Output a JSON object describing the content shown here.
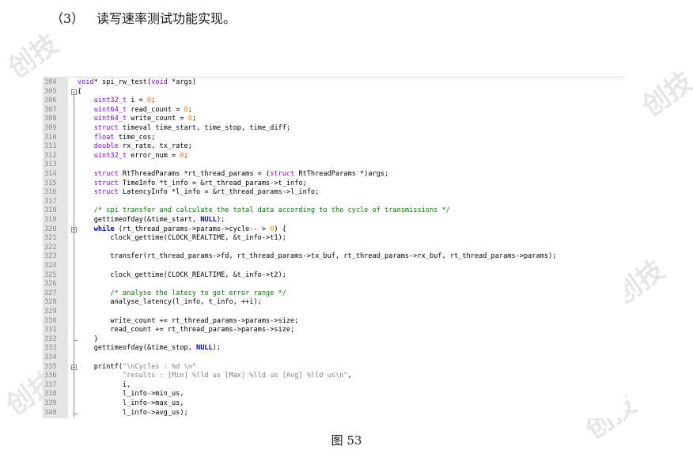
{
  "heading": {
    "number": "（3）",
    "title": "读写速率测试功能实现。"
  },
  "watermark": "创技",
  "caption": "图  53",
  "code_lines": [
    {
      "n": "304",
      "fold": "",
      "segs": [
        [
          "t",
          "void"
        ],
        [
          "",
          "* spi_rw_test("
        ],
        [
          "t",
          "void"
        ],
        [
          "",
          " *args)"
        ]
      ]
    },
    {
      "n": "305",
      "fold": "open",
      "segs": [
        [
          "",
          "{"
        ]
      ]
    },
    {
      "n": "306",
      "fold": "",
      "segs": [
        [
          "",
          "    "
        ],
        [
          "t",
          "uint32_t"
        ],
        [
          "",
          " i = "
        ],
        [
          "n",
          "0"
        ],
        [
          "",
          ";"
        ]
      ]
    },
    {
      "n": "307",
      "fold": "",
      "segs": [
        [
          "",
          "    "
        ],
        [
          "t",
          "uint64_t"
        ],
        [
          "",
          " read_count = "
        ],
        [
          "n",
          "0"
        ],
        [
          "",
          ";"
        ]
      ]
    },
    {
      "n": "308",
      "fold": "",
      "segs": [
        [
          "",
          "    "
        ],
        [
          "t",
          "uint64_t"
        ],
        [
          "",
          " write_count = "
        ],
        [
          "n",
          "0"
        ],
        [
          "",
          ";"
        ]
      ]
    },
    {
      "n": "309",
      "fold": "",
      "segs": [
        [
          "",
          "    "
        ],
        [
          "t",
          "struct"
        ],
        [
          "",
          " timeval time_start, time_stop, time_diff;"
        ]
      ]
    },
    {
      "n": "310",
      "fold": "",
      "segs": [
        [
          "",
          "    "
        ],
        [
          "t",
          "float"
        ],
        [
          "",
          " time_cos;"
        ]
      ]
    },
    {
      "n": "311",
      "fold": "",
      "segs": [
        [
          "",
          "    "
        ],
        [
          "t",
          "double"
        ],
        [
          "",
          " rx_rate, tx_rate;"
        ]
      ]
    },
    {
      "n": "312",
      "fold": "",
      "segs": [
        [
          "",
          "    "
        ],
        [
          "t",
          "uint32_t"
        ],
        [
          "",
          " error_num = "
        ],
        [
          "n",
          "0"
        ],
        [
          "",
          ";"
        ]
      ]
    },
    {
      "n": "313",
      "fold": "",
      "segs": []
    },
    {
      "n": "314",
      "fold": "",
      "segs": [
        [
          "",
          "    "
        ],
        [
          "t",
          "struct"
        ],
        [
          "",
          " RtThreadParams *rt_thread_params = ("
        ],
        [
          "t",
          "struct"
        ],
        [
          "",
          " RtThreadParams *)args;"
        ]
      ]
    },
    {
      "n": "315",
      "fold": "",
      "segs": [
        [
          "",
          "    "
        ],
        [
          "t",
          "struct"
        ],
        [
          "",
          " TimeInfo *t_info = &rt_thread_params->t_info;"
        ]
      ]
    },
    {
      "n": "316",
      "fold": "",
      "segs": [
        [
          "",
          "    "
        ],
        [
          "t",
          "struct"
        ],
        [
          "",
          " LatencyInfo *l_info = &rt_thread_params->l_info;"
        ]
      ]
    },
    {
      "n": "317",
      "fold": "",
      "segs": []
    },
    {
      "n": "318",
      "fold": "",
      "segs": [
        [
          "",
          "    "
        ],
        [
          "c",
          "/* spi transfer and calculate the total data according to the cycle of transmissions */"
        ]
      ]
    },
    {
      "n": "319",
      "fold": "",
      "segs": [
        [
          "",
          "    gettimeofday(&time_start, "
        ],
        [
          "k",
          "NULL"
        ],
        [
          "",
          ");"
        ]
      ]
    },
    {
      "n": "320",
      "fold": "open",
      "segs": [
        [
          "",
          "    "
        ],
        [
          "k",
          "while"
        ],
        [
          "",
          " (rt_thread_params->params->cycle-- > "
        ],
        [
          "n",
          "0"
        ],
        [
          "",
          ") {"
        ]
      ]
    },
    {
      "n": "321",
      "fold": "",
      "segs": [
        [
          "",
          "        clock_gettime(CLOCK_REALTIME, &t_info->t1);"
        ]
      ]
    },
    {
      "n": "322",
      "fold": "",
      "segs": []
    },
    {
      "n": "323",
      "fold": "",
      "segs": [
        [
          "",
          "        transfer(rt_thread_params->fd, rt_thread_params->tx_buf, rt_thread_params->rx_buf, rt_thread_params->params);"
        ]
      ]
    },
    {
      "n": "324",
      "fold": "",
      "segs": []
    },
    {
      "n": "325",
      "fold": "",
      "segs": [
        [
          "",
          "        clock_gettime(CLOCK_REALTIME, &t_info->t2);"
        ]
      ]
    },
    {
      "n": "326",
      "fold": "",
      "segs": []
    },
    {
      "n": "327",
      "fold": "",
      "segs": [
        [
          "",
          "        "
        ],
        [
          "c",
          "/* analyse the latecy to get error range */"
        ]
      ]
    },
    {
      "n": "328",
      "fold": "",
      "segs": [
        [
          "",
          "        analyse_latency(l_info, t_info, ++i);"
        ]
      ]
    },
    {
      "n": "329",
      "fold": "",
      "segs": []
    },
    {
      "n": "330",
      "fold": "",
      "segs": [
        [
          "",
          "        write_count += rt_thread_params->params->size;"
        ]
      ]
    },
    {
      "n": "331",
      "fold": "",
      "segs": [
        [
          "",
          "        read_count += rt_thread_params->params->size;"
        ]
      ]
    },
    {
      "n": "332",
      "fold": "end",
      "segs": [
        [
          "",
          "    }"
        ]
      ]
    },
    {
      "n": "333",
      "fold": "",
      "segs": [
        [
          "",
          "    gettimeofday(&time_stop, "
        ],
        [
          "k",
          "NULL"
        ],
        [
          "",
          ");"
        ]
      ]
    },
    {
      "n": "334",
      "fold": "",
      "segs": []
    },
    {
      "n": "335",
      "fold": "open",
      "segs": [
        [
          "",
          "    printf("
        ],
        [
          "s",
          "\"\\nCycles : %d \\n\""
        ]
      ]
    },
    {
      "n": "336",
      "fold": "",
      "segs": [
        [
          "",
          "           "
        ],
        [
          "s",
          "\"results : [Min] %lld us [Max] %lld us [Avg] %lld us\\n\""
        ],
        [
          "",
          ","
        ]
      ]
    },
    {
      "n": "337",
      "fold": "",
      "segs": [
        [
          "",
          "           i,"
        ]
      ]
    },
    {
      "n": "338",
      "fold": "",
      "segs": [
        [
          "",
          "           l_info->min_us,"
        ]
      ]
    },
    {
      "n": "339",
      "fold": "",
      "segs": [
        [
          "",
          "           l_info->max_us,"
        ]
      ]
    },
    {
      "n": "340",
      "fold": "end",
      "segs": [
        [
          "",
          "           l_info->avg_us);"
        ]
      ]
    }
  ]
}
